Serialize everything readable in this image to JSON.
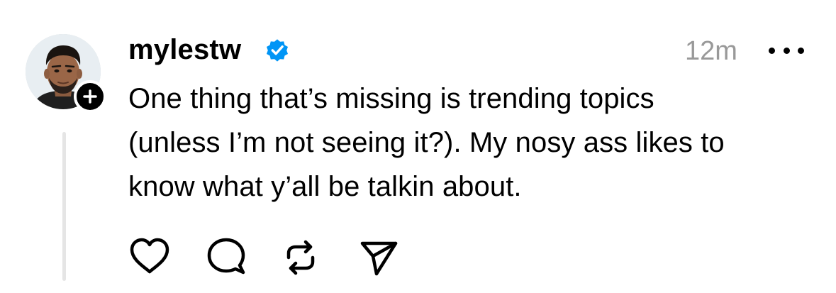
{
  "post": {
    "username": "mylestw",
    "timestamp": "12m",
    "text_lines": [
      "One thing that’s missing is trending topics",
      "(unless I’m not seeing it?). My nosy ass likes to",
      "know what y’all be talkin about."
    ],
    "verified": true
  },
  "icons": {
    "avatar": "profile-photo",
    "follow_badge": "plus-icon",
    "verified": "verified-badge-icon",
    "more": "more-dots-icon",
    "like": "heart-icon",
    "reply": "speech-bubble-icon",
    "repost": "repost-icon",
    "share": "send-icon"
  },
  "colors": {
    "verified_blue": "#0095f6",
    "timestamp_gray": "#999999",
    "thread_line": "#e5e5e5",
    "text": "#000000"
  }
}
